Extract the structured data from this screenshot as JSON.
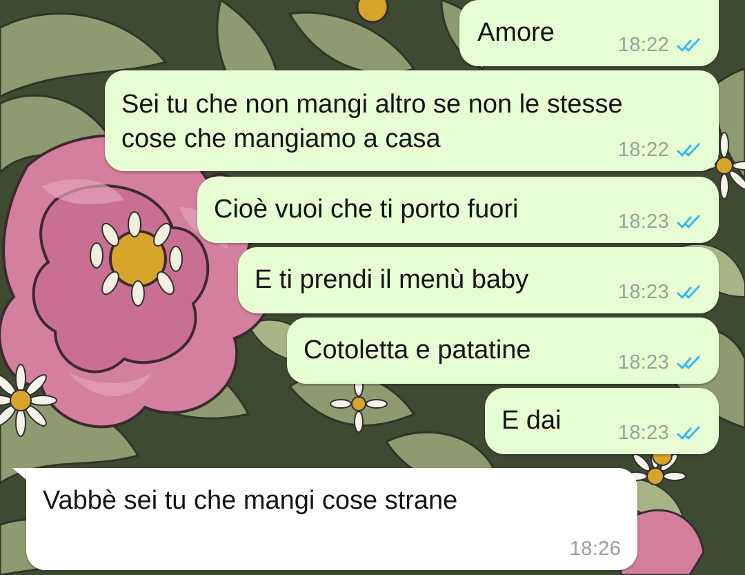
{
  "chat": {
    "messages": [
      {
        "direction": "out",
        "text": "Amore",
        "time": "18:22",
        "status": "read"
      },
      {
        "direction": "out",
        "text_lines": [
          "Sei tu che non mangi altro se non le stesse",
          "cose che mangiamo a casa"
        ],
        "time": "18:22",
        "status": "read"
      },
      {
        "direction": "out",
        "text": "Cioè vuoi che ti porto fuori",
        "time": "18:23",
        "status": "read"
      },
      {
        "direction": "out",
        "text": "E ti prendi il menù baby",
        "time": "18:23",
        "status": "read"
      },
      {
        "direction": "out",
        "text": "Cotoletta e patatine",
        "time": "18:23",
        "status": "read"
      },
      {
        "direction": "out",
        "text": "E dai",
        "time": "18:23",
        "status": "read"
      },
      {
        "direction": "in",
        "text": "Vabbè sei tu che mangi cose strane",
        "time": "18:26"
      }
    ]
  },
  "icons": {
    "read_receipt": "double-check-icon"
  },
  "colors": {
    "outgoing_bubble": "#e7fdd3",
    "incoming_bubble": "#ffffff",
    "read_tick": "#34b7f1",
    "time_text": "#9aa296"
  }
}
